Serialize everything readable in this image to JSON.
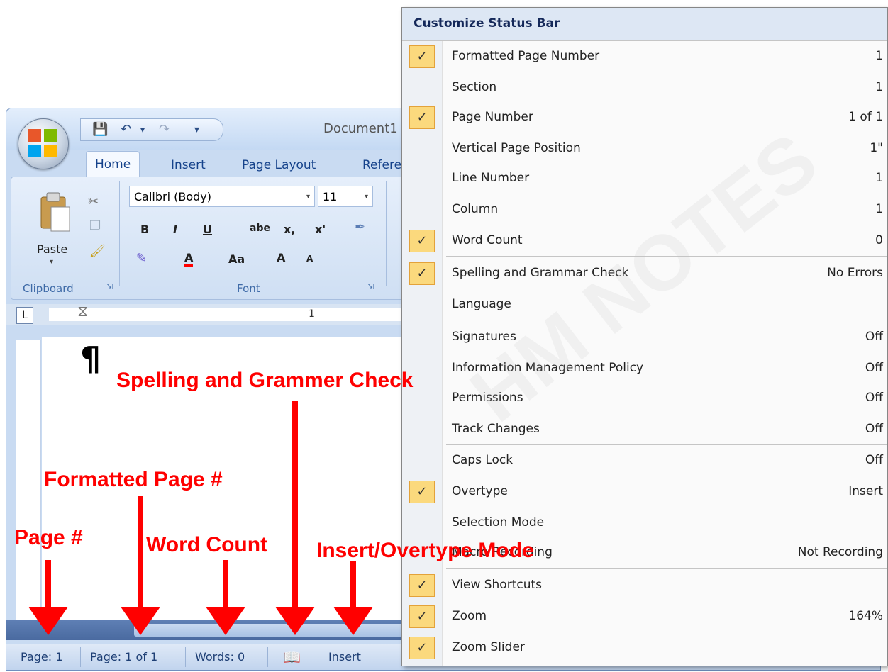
{
  "window": {
    "doc_title": "Document1",
    "tabs": [
      "Home",
      "Insert",
      "Page Layout",
      "Refere"
    ]
  },
  "ribbon": {
    "clipboard": {
      "paste_label": "Paste",
      "group_label": "Clipboard"
    },
    "font": {
      "font_name": "Calibri (Body)",
      "font_size": "11",
      "bold": "B",
      "italic": "I",
      "underline": "U",
      "strikethrough": "abe",
      "subscript": "x,",
      "superscript": "x'",
      "font_color": "A",
      "change_case": "Aa",
      "grow": "A",
      "shrink": "A",
      "group_label": "Font"
    }
  },
  "ruler": {
    "corner": "L",
    "marker": "1"
  },
  "status_bar": {
    "page": "Page: 1",
    "formatted_page": "Page: 1 of 1",
    "words": "Words: 0",
    "mode": "Insert"
  },
  "annotations": {
    "spelling": "Spelling and Grammer Check",
    "formatted_page": "Formatted Page #",
    "page": "Page #",
    "word_count": "Word Count",
    "insert_mode": "Insert/Overtype Mode"
  },
  "menu": {
    "title": "Customize Status Bar",
    "items": [
      {
        "label": "Formatted Page Number",
        "value": "1",
        "checked": true
      },
      {
        "label": "Section",
        "value": "1",
        "checked": false
      },
      {
        "label": "Page Number",
        "value": "1 of 1",
        "checked": true
      },
      {
        "label": "Vertical Page Position",
        "value": "1\"",
        "checked": false
      },
      {
        "label": "Line Number",
        "value": "1",
        "checked": false
      },
      {
        "label": "Column",
        "value": "1",
        "checked": false
      },
      {
        "label": "Word Count",
        "value": "0",
        "checked": true
      },
      {
        "label": "Spelling and Grammar Check",
        "value": "No Errors",
        "checked": true
      },
      {
        "label": "Language",
        "value": "",
        "checked": false
      },
      {
        "label": "Signatures",
        "value": "Off",
        "checked": false
      },
      {
        "label": "Information Management Policy",
        "value": "Off",
        "checked": false
      },
      {
        "label": "Permissions",
        "value": "Off",
        "checked": false
      },
      {
        "label": "Track Changes",
        "value": "Off",
        "checked": false
      },
      {
        "label": "Caps Lock",
        "value": "Off",
        "checked": false
      },
      {
        "label": "Overtype",
        "value": "Insert",
        "checked": true
      },
      {
        "label": "Selection Mode",
        "value": "",
        "checked": false
      },
      {
        "label": "Macro Recording",
        "value": "Not Recording",
        "checked": false
      },
      {
        "label": "View Shortcuts",
        "value": "",
        "checked": true
      },
      {
        "label": "Zoom",
        "value": "164%",
        "checked": true
      },
      {
        "label": "Zoom Slider",
        "value": "",
        "checked": true
      }
    ],
    "check_glyph": "✓"
  },
  "watermark": "HM NOTES",
  "colors": {
    "annotation": "#ff0000",
    "check_bg": "#fbd97d",
    "menu_header_text": "#15295a"
  }
}
